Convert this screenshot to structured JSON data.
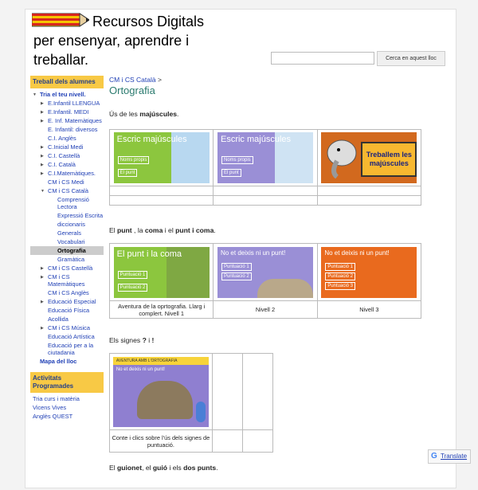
{
  "header": {
    "title_line1": "Recursos Digitals",
    "title_line2": "per ensenyar, aprendre i",
    "title_line3": "treballar.",
    "search_button": "Cerca en aquest lloc"
  },
  "sidebar": {
    "section1_title": "Treball dels alumnes",
    "items": [
      {
        "label": "Tria el teu nivell.",
        "level": 0,
        "arrow": "open",
        "bold": true
      },
      {
        "label": "E.Infantil LLENGUA",
        "level": 1,
        "arrow": "closed"
      },
      {
        "label": "E.Infantil. MEDI",
        "level": 1,
        "arrow": "closed"
      },
      {
        "label": "E. Inf. Matemàtiques",
        "level": 1,
        "arrow": "closed"
      },
      {
        "label": "E. Infantil: diversos",
        "level": 1,
        "arrow": "none"
      },
      {
        "label": "C.I. Anglès",
        "level": 1,
        "arrow": "none"
      },
      {
        "label": "C.Inicial Medi",
        "level": 1,
        "arrow": "closed"
      },
      {
        "label": "C.I. Castellà",
        "level": 1,
        "arrow": "closed"
      },
      {
        "label": "C.I. Català",
        "level": 1,
        "arrow": "closed"
      },
      {
        "label": "C.I.Matemàtiques.",
        "level": 1,
        "arrow": "closed"
      },
      {
        "label": "CM i CS Medi",
        "level": 1,
        "arrow": "none"
      },
      {
        "label": "CM i CS Català",
        "level": 1,
        "arrow": "open"
      },
      {
        "label": "Comprensió Lectora",
        "level": 2,
        "arrow": "none"
      },
      {
        "label": "Expressió Escrita",
        "level": 2,
        "arrow": "none"
      },
      {
        "label": "diccionaris",
        "level": 2,
        "arrow": "none"
      },
      {
        "label": "Generals",
        "level": 2,
        "arrow": "none"
      },
      {
        "label": "Vocabulari",
        "level": 2,
        "arrow": "none"
      },
      {
        "label": "Ortografia",
        "level": 2,
        "arrow": "none",
        "selected": true
      },
      {
        "label": "Gramàtica",
        "level": 2,
        "arrow": "none"
      },
      {
        "label": "CM i CS Castellà",
        "level": 1,
        "arrow": "closed"
      },
      {
        "label": "CM i CS Matemàtiques",
        "level": 1,
        "arrow": "closed"
      },
      {
        "label": "CM i CS Anglès",
        "level": 1,
        "arrow": "none"
      },
      {
        "label": "Educació Especial",
        "level": 1,
        "arrow": "closed"
      },
      {
        "label": "Educació Física",
        "level": 1,
        "arrow": "none"
      },
      {
        "label": "Acollida",
        "level": 1,
        "arrow": "none"
      },
      {
        "label": "CM i CS Música",
        "level": 1,
        "arrow": "closed"
      },
      {
        "label": "Educació Artística",
        "level": 1,
        "arrow": "none"
      },
      {
        "label": "Educació per a la ciutadania",
        "level": 1,
        "arrow": "none"
      },
      {
        "label": "Mapa del lloc",
        "level": 0,
        "arrow": "none",
        "bold": true
      }
    ],
    "section2_title": "Activitats Programades",
    "items2": [
      {
        "label": "Tria curs i matèria"
      },
      {
        "label": "Vicens Vives"
      },
      {
        "label": "Anglès QUEST"
      }
    ]
  },
  "breadcrumb": {
    "link": "CM i CS Català",
    "sep": ">"
  },
  "page_title": "Ortografia",
  "sections": {
    "s1": {
      "pre": "Ús de les ",
      "bold": "majúscules",
      "post": "."
    },
    "s2": {
      "a": "El ",
      "b": "punt",
      "c": " ,  la ",
      "d": "coma",
      "e": " i el ",
      "f": "punt i coma",
      "g": "."
    },
    "s3": {
      "a": "Els signes  ",
      "b": "?",
      "c": "  i  ",
      "d": "!"
    },
    "s4": {
      "a": "El ",
      "b": "guionet",
      "c": ", el ",
      "d": "guió",
      "e": " i els ",
      "f": "dos punts",
      "g": "."
    }
  },
  "thumbs": {
    "t1": {
      "title": "Escric majúscules",
      "chip1": "Noms propis",
      "chip2": "El punt"
    },
    "t2": {
      "title": "Escric majúscules",
      "chip1": "Noms propis",
      "chip2": "El punt"
    },
    "t3": {
      "title": "Treballem les majúscules"
    },
    "t4": {
      "title": "El punt i la coma",
      "chip1": "Puntuació 1",
      "chip2": "Puntuació 2"
    },
    "t5": {
      "title": "No et deixis ni un punt!",
      "chip1": "Puntuació 1",
      "chip2": "Puntuació 2"
    },
    "t6": {
      "title": "No et deixis ni un punt!",
      "chip1": "Puntuació 1",
      "chip2": "Puntuació 2",
      "chip3": "Puntuació 3"
    },
    "t7": {
      "header": "AVENTURA AMB L'ORTOGRAFIA",
      "title": "No et deixis ni un punt!"
    }
  },
  "captions": {
    "c4": "Aventura de la oprtografia. Llarg i complert. Nivell 1",
    "c5": "Nivell 2",
    "c6": "Nivell 3",
    "c7": "Conte i clics  sobre l'ús dels signes de puntuació."
  },
  "translate": {
    "icon": "G",
    "label": "Translate"
  }
}
